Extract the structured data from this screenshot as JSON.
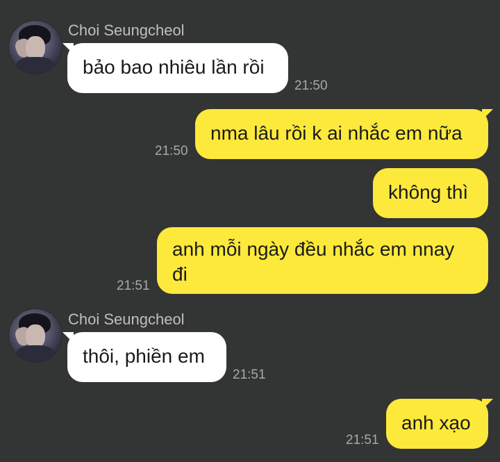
{
  "contact": {
    "name": "Choi Seungcheol"
  },
  "colors": {
    "background": "#333434",
    "incoming_bubble": "#ffffff",
    "outgoing_bubble": "#fde93b",
    "timestamp": "#a9a9a9",
    "sender_name": "#bfbfbf"
  },
  "messages": [
    {
      "direction": "incoming",
      "sender": "Choi Seungcheol",
      "text": "bảo bao nhiêu lần rồi",
      "time": "21:50"
    },
    {
      "direction": "outgoing",
      "text": "nma lâu rồi k ai nhắc em nữa",
      "time": "21:50"
    },
    {
      "direction": "outgoing",
      "text": "không thì",
      "time": ""
    },
    {
      "direction": "outgoing",
      "text": "anh mỗi ngày đều nhắc em nnay đi",
      "time": "21:51"
    },
    {
      "direction": "incoming",
      "sender": "Choi Seungcheol",
      "text": "thôi, phiền em",
      "time": "21:51"
    },
    {
      "direction": "outgoing",
      "text": "anh xạo",
      "time": "21:51"
    }
  ]
}
